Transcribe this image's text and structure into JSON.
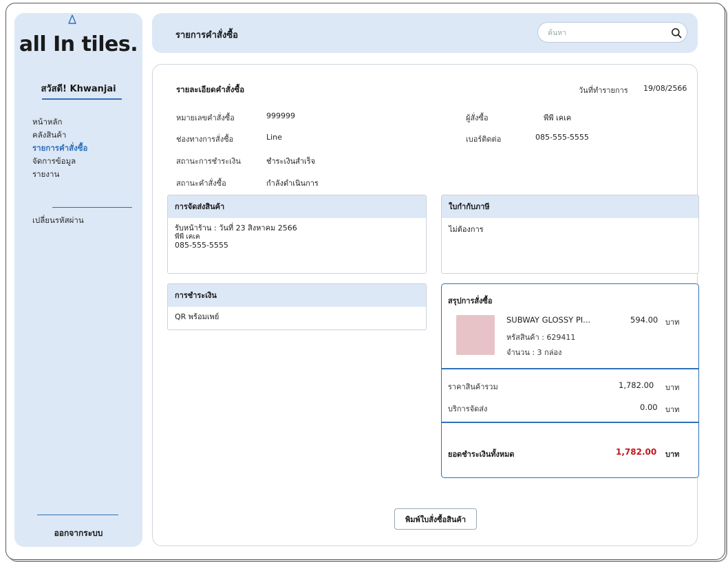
{
  "sidebar": {
    "logo": "all In tiles.",
    "greeting": "สวัสดี! Khwanjai",
    "items": [
      {
        "label": "หน้าหลัก"
      },
      {
        "label": "คลังสินค้า"
      },
      {
        "label": "รายการคำสั่งซื้อ"
      },
      {
        "label": "จัดการข้อมูล"
      },
      {
        "label": "รายงาน"
      }
    ],
    "change_password": "เปลี่ยนรหัสผ่าน",
    "logout": "ออกจากระบบ"
  },
  "header": {
    "title": "รายการคำสั่งซื้อ",
    "search_placeholder": "ค้นหา"
  },
  "order": {
    "section_title": "รายละเอียดคำสั่งซื้อ",
    "date_label": "วันที่ทำรายการ",
    "date_value": "19/08/2566",
    "order_no_label": "หมายเลขคำสั่งซื้อ",
    "order_no": "999999",
    "channel_label": "ช่องทางการสั่งซื้อ",
    "channel": "Line",
    "payment_status_label": "สถานะการชำระเงิน",
    "payment_status": "ชำระเงินสำเร็จ",
    "order_status_label": "สถานะคำสั่งซื้อ",
    "order_status": "กำลังดำเนินการ",
    "buyer_label": "ผู้สั่งซื้อ",
    "buyer": "พีพี เคเค",
    "phone_label": "เบอร์ติดต่อ",
    "phone": "085-555-5555"
  },
  "shipping": {
    "title": "การจัดส่งสินค้า",
    "line1": "รับหน้าร้าน : วันที่ 23 สิงหาคม 2566",
    "line2": "พีพี เคเค",
    "line3": "085-555-5555"
  },
  "tax_invoice": {
    "title": "ใบกำกับภาษี",
    "value": "ไม่ต้องการ"
  },
  "payment": {
    "title": "การชำระเงิน",
    "value": "QR พร้อมเพย์"
  },
  "summary": {
    "title": "สรุปการสั่งซื้อ",
    "item_name": "SUBWAY GLOSSY PI...",
    "item_price": "594.00",
    "currency": "บาท",
    "item_code": "หรัสสินค้า : 629411",
    "item_qty": "จำนวน : 3  กล่อง",
    "subtotal_label": "ราคาสินค้ารวม",
    "subtotal": "1,782.00",
    "shipping_label": "บริการจัดส่ง",
    "shipping_fee": "0.00",
    "total_label": "ยอดชำระเงินทั้งหมด",
    "total": "1,782.00"
  },
  "actions": {
    "print_label": "พิมพ์ใบสั่งซื้อสินค้า"
  },
  "colors": {
    "accent": "#2f6fb7",
    "panel_bg": "#dce8f6",
    "total_red": "#c0171e"
  }
}
